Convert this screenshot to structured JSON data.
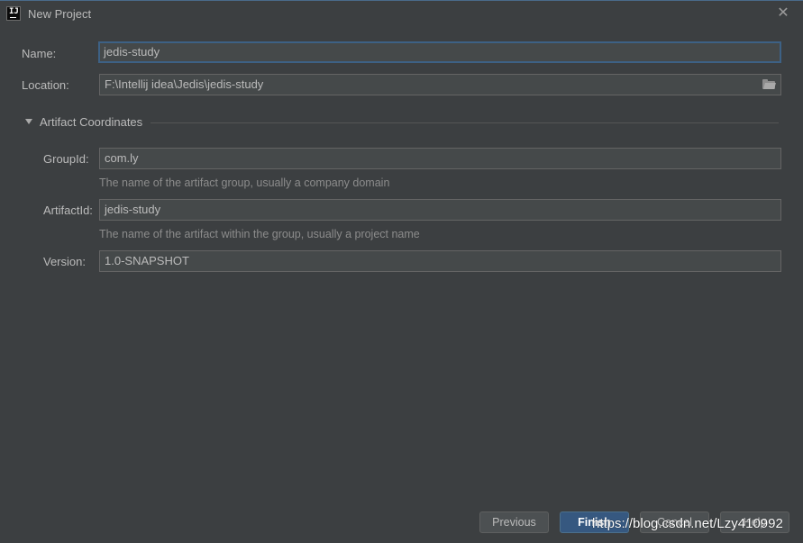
{
  "window": {
    "title": "New Project",
    "app_icon_text": "IJ",
    "close_glyph": "✕"
  },
  "form": {
    "name_label": "Name:",
    "name_value": "jedis-study",
    "location_label": "Location:",
    "location_value": "F:\\Intellij idea\\Jedis\\jedis-study"
  },
  "artifact": {
    "section_title": "Artifact Coordinates",
    "expanded": true,
    "group_label": "GroupId:",
    "group_value": "com.ly",
    "group_hint": "The name of the artifact group, usually a company domain",
    "artifact_label": "ArtifactId:",
    "artifact_value": "jedis-study",
    "artifact_hint": "The name of the artifact within the group, usually a project name",
    "version_label": "Version:",
    "version_value": "1.0-SNAPSHOT"
  },
  "buttons": {
    "previous": "Previous",
    "finish": "Finish",
    "cancel": "Cancel",
    "help": "Help"
  },
  "watermark": "https://blog.csdn.net/Lzy410992",
  "icons": {
    "app": "intellij-icon",
    "close": "close-icon",
    "folder": "folder-icon",
    "expand": "triangle-down-icon"
  },
  "colors": {
    "background": "#3c3f41",
    "field_bg": "#45494a",
    "focus_border": "#3d6185",
    "primary_button": "#365880",
    "hint_text": "#8c8c8c"
  }
}
